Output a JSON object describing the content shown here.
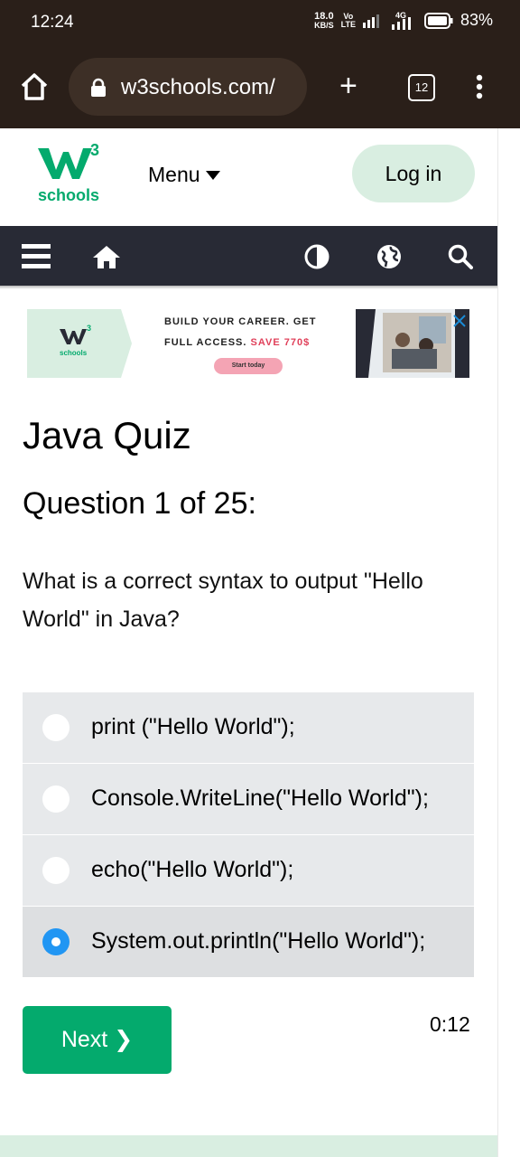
{
  "status_bar": {
    "time": "12:24",
    "speed_value": "18.0",
    "speed_unit": "KB/S",
    "volte_top": "Vo",
    "volte_bottom": "LTE",
    "network": "4G",
    "battery": "83%"
  },
  "browser": {
    "url": "w3schools.com/",
    "tab_count": "12"
  },
  "header": {
    "logo_text": "schools",
    "logo_superscript": "3",
    "menu_label": "Menu",
    "login_label": "Log in"
  },
  "ad": {
    "logo_text": "schools",
    "logo_superscript": "3",
    "line1": "BUILD YOUR CAREER. GET",
    "line2_prefix": "FULL ACCESS.",
    "line2_highlight": "SAVE 770$",
    "cta": "Start today"
  },
  "quiz": {
    "title": "Java Quiz",
    "question_count": "Question 1 of 25:",
    "question_text": "What is a correct syntax to output \"Hello World\" in Java?",
    "options": [
      {
        "label": "print (\"Hello World\");",
        "selected": false
      },
      {
        "label": "Console.WriteLine(\"Hello World\");",
        "selected": false
      },
      {
        "label": "echo(\"Hello World\");",
        "selected": false
      },
      {
        "label": "System.out.println(\"Hello World\");",
        "selected": true
      }
    ],
    "next_label": "Next ❯",
    "timer": "0:12"
  },
  "colors": {
    "brand_green": "#04aa6d",
    "nav_dark": "#282a35",
    "login_bg": "#d9eee1",
    "radio_selected": "#2196f3"
  },
  "icons": [
    "home-icon",
    "lock-icon",
    "plus-icon",
    "tabs-icon",
    "kebab-icon",
    "hamburger-icon",
    "house-icon",
    "contrast-icon",
    "globe-icon",
    "search-icon",
    "caret-down-icon",
    "close-icon"
  ]
}
